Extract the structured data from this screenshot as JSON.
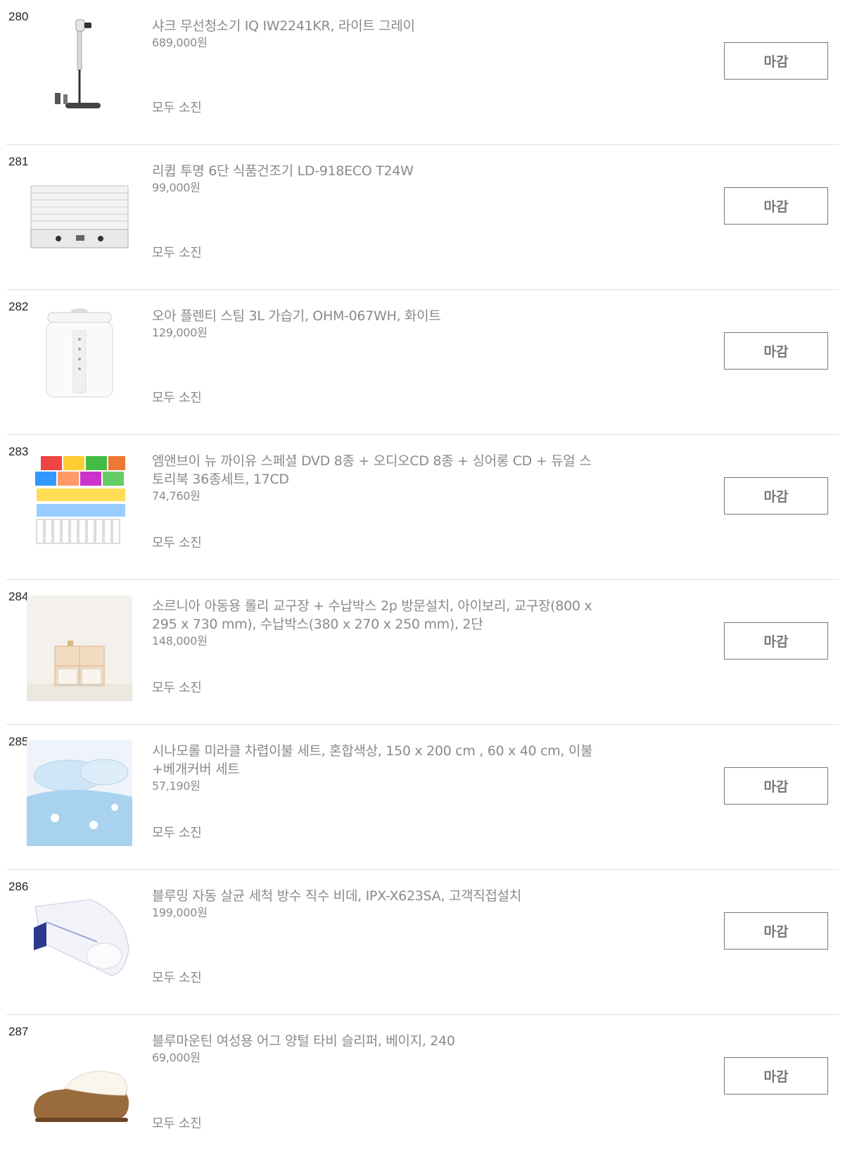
{
  "products": [
    {
      "number": "280",
      "title": "샤크 무선청소기 IQ IW2241KR, 라이트 그레이",
      "price": "689,000원",
      "stock_status": "모두 소진",
      "button_label": "마감",
      "image": "stick-vacuum"
    },
    {
      "number": "281",
      "title": "리큅 투명 6단 식품건조기 LD-918ECO T24W",
      "price": "99,000원",
      "stock_status": "모두 소진",
      "button_label": "마감",
      "image": "food-dehydrator"
    },
    {
      "number": "282",
      "title": "오아 플렌티 스팀 3L 가습기, OHM-067WH, 화이트",
      "price": "129,000원",
      "stock_status": "모두 소진",
      "button_label": "마감",
      "image": "humidifier"
    },
    {
      "number": "283",
      "title": "엠앤브이 뉴 까이유 스페셜 DVD 8종 + 오디오CD 8종 + 싱어롱 CD + 듀얼 스토리북 36종세트, 17CD",
      "price": "74,760원",
      "stock_status": "모두 소진",
      "button_label": "마감",
      "image": "dvd-book-set"
    },
    {
      "number": "284",
      "title": "소르니아 아동용 롤리 교구장 + 수납박스 2p 방문설치, 아이보리, 교구장(800 x 295 x 730 mm), 수납박스(380 x 270 x 250 mm), 2단",
      "price": "148,000원",
      "stock_status": "모두 소진",
      "button_label": "마감",
      "image": "kids-shelf"
    },
    {
      "number": "285",
      "title": "시나모롤 미라클 차렵이불 세트, 혼합색상, 150 x 200 cm , 60 x 40 cm, 이불+베개커버 세트",
      "price": "57,190원",
      "stock_status": "모두 소진",
      "button_label": "마감",
      "image": "bedding-set"
    },
    {
      "number": "286",
      "title": "블루밍 자동 살균 세척 방수 직수 비데, IPX-X623SA, 고객직접설치",
      "price": "199,000원",
      "stock_status": "모두 소진",
      "button_label": "마감",
      "image": "bidet"
    },
    {
      "number": "287",
      "title": "블루마운틴 여성용 어그 양털 타비 슬리퍼, 베이지, 240",
      "price": "69,000원",
      "stock_status": "모두 소진",
      "button_label": "마감",
      "image": "fur-slipper"
    }
  ]
}
